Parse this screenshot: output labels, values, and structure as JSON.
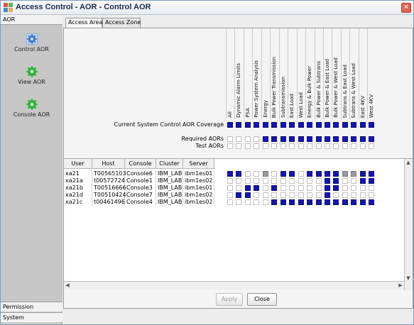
{
  "window": {
    "title": "Access Control - AOR - Control AOR",
    "close_glyph": "✕"
  },
  "left": {
    "header": "AOR",
    "items": [
      {
        "label": "Control AOR",
        "icon": "gear-icon"
      },
      {
        "label": "View AOR",
        "icon": "gear-icon"
      },
      {
        "label": "Console AOR",
        "icon": "gear-icon"
      }
    ],
    "footer": [
      "Permission",
      "System"
    ]
  },
  "tabs": [
    "Access Area",
    "Access Zone"
  ],
  "columns": [
    "All",
    "Dynamic Alarm Limits",
    "PSA",
    "Power System Analysis",
    "Energy",
    "Bulk Power Transmission",
    "Subtransmission",
    "East Load",
    "West Load",
    "Energy & Bulk Power",
    "Bulk Power & Subtrans",
    "Bulk Power & East Load",
    "Bulk Power & West Load",
    "Subtrans & East Load",
    "Subtrans & West Load",
    "East 4KV",
    "West 4KV"
  ],
  "coverage": {
    "label": "Current System Control AOR Coverage",
    "values": [
      1,
      1,
      1,
      1,
      1,
      1,
      1,
      1,
      1,
      1,
      1,
      1,
      1,
      1,
      1,
      1,
      1
    ]
  },
  "required": {
    "label": "Required AORs",
    "values": [
      0,
      0,
      0,
      0,
      1,
      1,
      1,
      1,
      1,
      1,
      1,
      1,
      1,
      1,
      1,
      1,
      1
    ]
  },
  "test": {
    "label": "Test AORs",
    "values": [
      0,
      0,
      0,
      0,
      0,
      0,
      0,
      0,
      0,
      0,
      0,
      0,
      0,
      0,
      0,
      0,
      0
    ]
  },
  "table": {
    "headers": [
      "User",
      "Host",
      "Console",
      "Cluster",
      "Server"
    ],
    "rows": [
      {
        "cells": [
          "xa21",
          "T00565103",
          "Console6",
          "IBM_LAB",
          "ibm1es01"
        ],
        "aor": [
          1,
          1,
          0,
          0,
          2,
          0,
          1,
          1,
          0,
          1,
          1,
          1,
          1,
          2,
          2,
          1,
          1
        ]
      },
      {
        "cells": [
          "xa21a",
          "t00572724",
          "Console1",
          "IBM_LAB",
          "ibm1es02"
        ],
        "aor": [
          0,
          0,
          0,
          0,
          0,
          0,
          0,
          0,
          0,
          0,
          0,
          1,
          1,
          0,
          0,
          1,
          1
        ]
      },
      {
        "cells": [
          "xa21b",
          "T00516666",
          "Console3",
          "IBM_LAB",
          "ibm1es01"
        ],
        "aor": [
          0,
          0,
          1,
          1,
          0,
          1,
          0,
          0,
          0,
          0,
          0,
          1,
          1,
          0,
          0,
          0,
          0
        ]
      },
      {
        "cells": [
          "xa21d",
          "T00510424",
          "Console7",
          "IBM_LAB",
          "ibm1es02"
        ],
        "aor": [
          0,
          1,
          1,
          0,
          0,
          0,
          0,
          0,
          0,
          0,
          0,
          1,
          0,
          0,
          0,
          0,
          0
        ]
      },
      {
        "cells": [
          "xa21c",
          "t00461496",
          "Console4",
          "IBM_LAB",
          "ibm1es02"
        ],
        "aor": [
          0,
          0,
          0,
          0,
          0,
          1,
          1,
          1,
          1,
          1,
          1,
          1,
          1,
          1,
          1,
          1,
          1
        ]
      }
    ]
  },
  "buttons": {
    "apply": "Apply",
    "close": "Close"
  },
  "colors": {
    "on": "#1515b0",
    "off": "#ffffff",
    "gray": "#9a9a9a"
  }
}
